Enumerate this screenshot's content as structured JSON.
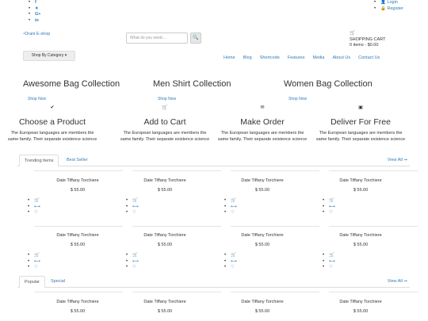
{
  "social": [
    {
      "icon": "facebook-icon",
      "glyph": "f"
    },
    {
      "icon": "twitter-icon",
      "glyph": "🐦"
    },
    {
      "icon": "google-plus-icon",
      "glyph": "G+"
    },
    {
      "icon": "linkedin-icon",
      "glyph": "in"
    }
  ],
  "account": {
    "login": "Login",
    "register": "Register"
  },
  "logo_alt": "Orani E-shop",
  "search": {
    "placeholder": "What do you need....",
    "button_icon": "search-icon"
  },
  "cart": {
    "title": "SHOPPING CART",
    "summary": "0 items - $0.00"
  },
  "category_button": "Shop By Category ▾",
  "nav": [
    "Home",
    "Blog",
    "Shortcode",
    "Features",
    "Media",
    "About Us",
    "Contact Us"
  ],
  "collections": [
    {
      "title": "Awesome Bag Collection",
      "link": "Shop Now"
    },
    {
      "title": "Men Shirt Collection",
      "link": "Shop Now"
    },
    {
      "title": "Women Bag Collection",
      "link": "Shop Now"
    }
  ],
  "features": [
    {
      "icon": "checkmark-icon",
      "glyph": "✔",
      "title": "Choose a Product",
      "desc": "The European languages are members the same family. Their separate existence science"
    },
    {
      "icon": "cart-icon",
      "glyph": "🛒",
      "title": "Add to Cart",
      "desc": "The European languages are members the same family. Their separate existence science"
    },
    {
      "icon": "order-icon",
      "glyph": "✉",
      "title": "Make Order",
      "desc": "The European languages are members the same family. Their separate existence science"
    },
    {
      "icon": "deliver-icon",
      "glyph": "▣",
      "title": "Deliver For Free",
      "desc": "The European languages are members the same family. Their separate existence science"
    }
  ],
  "section1": {
    "tabs": [
      "Trending Items",
      "Best Seller"
    ],
    "view_all": "View All ➞"
  },
  "section2": {
    "tabs": [
      "Popular",
      "Special"
    ],
    "view_all": "View All ➞"
  },
  "product": {
    "name": "Date Tiffany Torchiere",
    "price": "$ 55.00"
  },
  "product_actions": [
    {
      "icon": "add-to-cart-icon",
      "glyph": "🛒"
    },
    {
      "icon": "compare-icon",
      "glyph": "⟷"
    },
    {
      "icon": "wishlist-icon",
      "glyph": "♡"
    }
  ]
}
